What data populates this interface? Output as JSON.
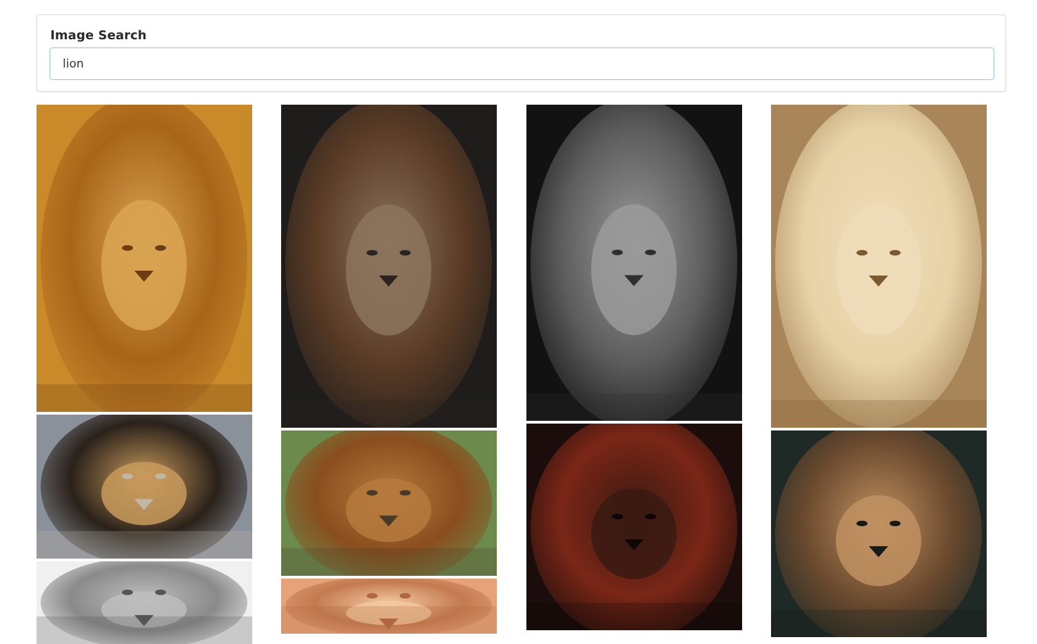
{
  "search": {
    "title": "Image Search",
    "query": "lion"
  },
  "results": {
    "columns": [
      {
        "tiles": [
          {
            "subject": "lion-portrait-golden",
            "colors": {
              "bg": "#c98a2a",
              "mane": "#a8651a",
              "face": "#d9a452",
              "shade": "#6a3d12"
            }
          },
          {
            "subject": "lion-standing-enclosure",
            "colors": {
              "bg": "#8b919b",
              "mane": "#2a211a",
              "face": "#c89a5c",
              "shade": "#bfb7a8"
            }
          },
          {
            "subject": "lion-bw-sleeping",
            "colors": {
              "bg": "#f0f0f0",
              "mane": "#8a8a8a",
              "face": "#bdbdbd",
              "shade": "#555555"
            }
          }
        ]
      },
      {
        "tiles": [
          {
            "subject": "lion-portrait-dark",
            "colors": {
              "bg": "#1f1d1c",
              "mane": "#5a3b25",
              "face": "#8c735c",
              "shade": "#2a2420"
            }
          },
          {
            "subject": "lion-walking-grass",
            "colors": {
              "bg": "#6b8a4c",
              "mane": "#8a4e1e",
              "face": "#b57a3c",
              "shade": "#4a3a28"
            }
          },
          {
            "subject": "lion-sunset",
            "colors": {
              "bg": "#e6a37a",
              "mane": "#c47a50",
              "face": "#f2c9a0",
              "shade": "#b06840"
            }
          }
        ]
      },
      {
        "tiles": [
          {
            "subject": "lion-portrait-bw",
            "colors": {
              "bg": "#121212",
              "mane": "#5c5c5c",
              "face": "#9a9a9a",
              "shade": "#2e2e2e"
            }
          },
          {
            "subject": "lion-red-light",
            "colors": {
              "bg": "#1a0d0b",
              "mane": "#7a2616",
              "face": "#3a1a12",
              "shade": "#0e0706"
            }
          }
        ]
      },
      {
        "tiles": [
          {
            "subject": "lion-white-lying",
            "colors": {
              "bg": "#a9865a",
              "mane": "#e8d3a8",
              "face": "#efdcb8",
              "shade": "#7a5a30"
            }
          },
          {
            "subject": "lion-dark-green",
            "colors": {
              "bg": "#1f2926",
              "mane": "#6b4a2e",
              "face": "#c09060",
              "shade": "#141b19"
            }
          }
        ]
      }
    ]
  }
}
